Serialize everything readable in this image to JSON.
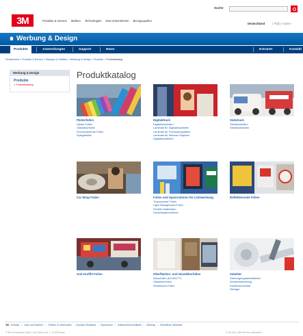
{
  "header": {
    "logo": "3M",
    "topnav": [
      "Produkte & Service",
      "Marken",
      "Technologien",
      "Das Unternehmen",
      "Bezugsquellen"
    ],
    "search_label": "Suche",
    "country_selected": "Deutschland",
    "country_extra": "| 中国 | Andere"
  },
  "banner": {
    "title": "Werbung & Design"
  },
  "nav": {
    "items": [
      "Produkte",
      "Anwendungen",
      "Support",
      "News"
    ],
    "right_items": [
      "Extranet",
      "Kontakt"
    ]
  },
  "breadcrumb": {
    "path": "Deutschland > Produkte & Service > Displays & Grafiken > Werbung & Design > Produkte > ",
    "current": "Produktkatalog"
  },
  "sidebar": {
    "heading": "Werbung & Design",
    "section": "Produkte",
    "current": "> Produktkatalog"
  },
  "main": {
    "title": "Produktkatalog",
    "cards": [
      {
        "title": "Plotterfolien",
        "links": [
          "Opake Folien",
          "Glasdekorfolien",
          "Fluoreszierende Folien",
          "Spiegelfolien"
        ]
      },
      {
        "title": "Digitaldruck",
        "links": [
          "Digitaldruckfolien",
          "Laminate für Digitaldruckfolien",
          "Laminate für Fußbodengrafiken",
          "Laminate für Window Graphics",
          "Digitaldrucktinten"
        ]
      },
      {
        "title": "Siebdruck",
        "links": [
          "Siebdruckfolien",
          "Siebdruckfarben"
        ]
      },
      {
        "title": "Car Wrap Folien",
        "links": []
      },
      {
        "title": "Folien und Spannrahmen für Lichtwerbung",
        "links": [
          "Transluzente Folien",
          "Light Management Folien",
          "Flexible Materialien",
          "Schnellspannrahmen"
        ]
      },
      {
        "title": "Reflektierende Folien",
        "links": []
      },
      {
        "title": "Anti-Graffiti Folien",
        "links": []
      },
      {
        "title": "Oberflächen- und Glasdekorfolien",
        "links": [
          "Dekorfolien (DI-NOC™)",
          "Glasdekorfolien",
          "Whiteboard Folien"
        ]
      },
      {
        "title": "Zubehör",
        "links": [
          "Übertragungsklebebänder",
          "Verarbeitwerkzeug",
          "Kantenschutzlack",
          "Reiniger"
        ]
      }
    ]
  },
  "footer": {
    "logo": "3M",
    "links": [
      "Kontakt",
      "Jobs und Karriere",
      "Partner & Lieferanten",
      "Investor Relations",
      "Impressum",
      "Datenschutzrichtlinien",
      "Sitemap",
      "Rechtliche Hinweise"
    ],
    "copyright_left": "© 3M Deutschland GmbH, Carl-Schurz-Str. 1, 41453 Neuss",
    "copyright_right": "© 3M 2011. Alle Rechte vorbehalten."
  },
  "colors": {
    "brand_red": "#e2001a",
    "header_blue": "#0059a3",
    "nav_blue": "#003f7d",
    "link_blue": "#1b5ea8"
  }
}
